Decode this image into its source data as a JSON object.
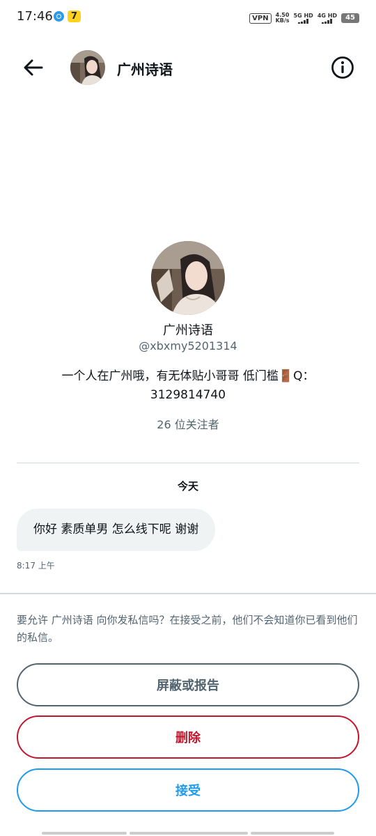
{
  "status_bar": {
    "time": "17:46",
    "app_icon_2_glyph": "7",
    "vpn": "VPN",
    "speed_value": "4.50",
    "speed_unit": "KB/s",
    "sim1": "5G HD",
    "sim2": "4G HD",
    "battery": "45"
  },
  "header": {
    "title": "广州诗语",
    "back_icon": "arrow-left-icon",
    "info_icon": "info-circle-icon"
  },
  "profile": {
    "name": "广州诗语",
    "handle": "@xbxmy5201314",
    "bio": "一个人在广州哦，有无体贴小哥哥 低门槛🚪Q：3129814740",
    "followers": "26 位关注者"
  },
  "conversation": {
    "date_label": "今天",
    "messages": [
      {
        "text": "你好 素质单男 怎么线下呢 谢谢",
        "time": "8:17 上午"
      }
    ]
  },
  "request": {
    "text": "要允许 广州诗语 向你发私信吗？在接受之前，他们不会知道你已看到他们的私信。",
    "block_label": "屏蔽或报告",
    "delete_label": "删除",
    "accept_label": "接受"
  },
  "colors": {
    "text_primary": "#0f1419",
    "text_secondary": "#536471",
    "danger": "#c5162e",
    "accent": "#1d9bf0",
    "bubble_bg": "#eff3f4"
  }
}
